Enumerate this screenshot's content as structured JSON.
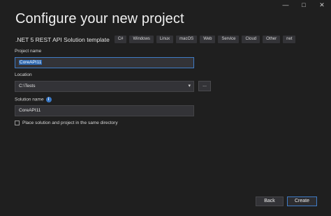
{
  "window": {
    "minimize": "—",
    "maximize": "□",
    "close": "✕"
  },
  "title": "Configure your new project",
  "template": {
    "name": ".NET 5 REST API Solution template",
    "tags": [
      "C#",
      "Windows",
      "Linux",
      "macOS",
      "Web",
      "Service",
      "Cloud",
      "Other",
      "net"
    ]
  },
  "project_name": {
    "label": "Project name",
    "value": "CoreAPI11"
  },
  "location": {
    "label": "Location",
    "value": "C:\\Tests",
    "browse": "..."
  },
  "solution_name": {
    "label": "Solution name",
    "value": "CoreAPI11",
    "info": "i"
  },
  "checkbox": {
    "label": "Place solution and project in the same directory",
    "checked": false
  },
  "buttons": {
    "back": "Back",
    "create": "Create"
  }
}
